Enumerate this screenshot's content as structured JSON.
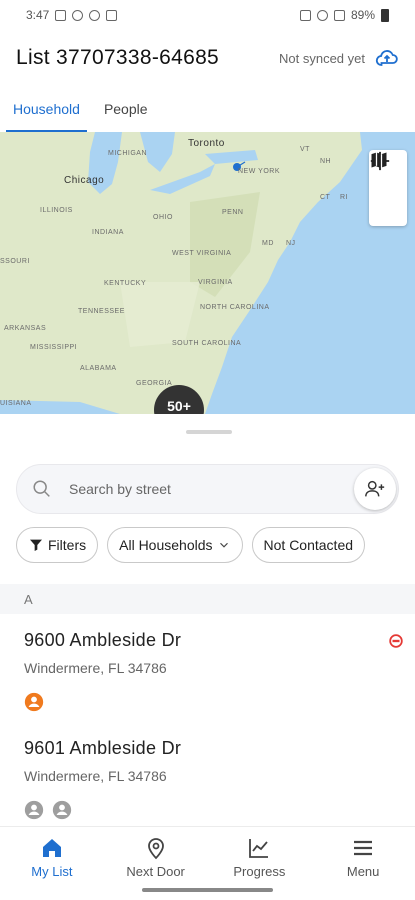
{
  "status_bar": {
    "time": "3:47",
    "battery": "89%"
  },
  "header": {
    "title": "List 37707338-64685",
    "sync_status": "Not synced yet"
  },
  "tabs": [
    {
      "label": "Household",
      "active": true
    },
    {
      "label": "People",
      "active": false
    }
  ],
  "map": {
    "cities": {
      "toronto": "Toronto",
      "chicago": "Chicago"
    },
    "states": {
      "michigan": "MICHIGAN",
      "illinois": "ILLINOIS",
      "indiana": "INDIANA",
      "ohio": "OHIO",
      "penn": "PENN",
      "new_york": "NEW YORK",
      "nj": "NJ",
      "md": "MD",
      "ct": "CT",
      "ri": "RI",
      "nh": "NH",
      "vt": "VT",
      "west_virginia": "WEST VIRGINIA",
      "virginia": "VIRGINIA",
      "kentucky": "KENTUCKY",
      "tennessee": "TENNESSEE",
      "north_carolina": "NORTH CAROLINA",
      "south_carolina": "SOUTH CAROLINA",
      "georgia": "GEORGIA",
      "alabama": "ALABAMA",
      "mississippi": "MISSISSIPPI",
      "arkansas": "ARKANSAS",
      "missouri": "SSOURI",
      "louisiana": "UISIANA"
    },
    "cluster_label": "50+"
  },
  "search": {
    "placeholder": "Search by street"
  },
  "filters": {
    "filters_label": "Filters",
    "households_label": "All Households",
    "status_label": "Not Contacted"
  },
  "section_letter": "A",
  "households": [
    {
      "address": "9600 Ambleside Dr",
      "city": "Windermere, FL 34786",
      "people": [
        {
          "icon": "person-icon",
          "color": "#f07a1e"
        }
      ],
      "status_icon": "minus-circle-icon",
      "status_color": "#e53935"
    },
    {
      "address": "9601 Ambleside Dr",
      "city": "Windermere, FL 34786",
      "people": [
        {
          "icon": "person-icon",
          "color": "#9e9e9e"
        },
        {
          "icon": "person-icon",
          "color": "#9e9e9e"
        }
      ]
    }
  ],
  "bottom_nav": [
    {
      "label": "My List",
      "icon": "home-icon",
      "active": true
    },
    {
      "label": "Next Door",
      "icon": "location-pin-icon",
      "active": false
    },
    {
      "label": "Progress",
      "icon": "chart-icon",
      "active": false
    },
    {
      "label": "Menu",
      "icon": "menu-icon",
      "active": false
    }
  ],
  "colors": {
    "accent": "#1f6fcf",
    "map_land": "#dfe8c9",
    "map_water": "#aad3f2"
  }
}
